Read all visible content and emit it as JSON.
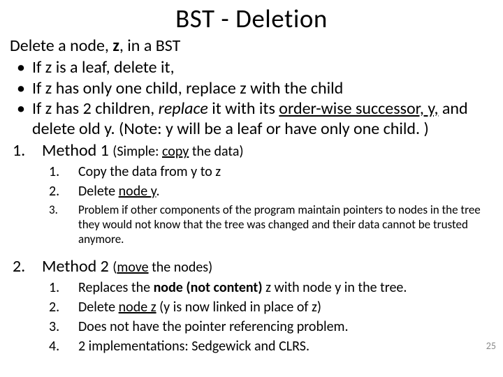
{
  "title": "BST - Deletion",
  "intro_pre": "Delete a node, ",
  "intro_z": "z",
  "intro_post": ", in a BST",
  "bul_mark": "•",
  "b1": "If z is a leaf, delete it,",
  "b2": "If z has only one child, replace z with the child",
  "b3_a": "If z has 2 children, ",
  "b3_replace": "replace",
  "b3_b": " it with its ",
  "b3_succ": "order-wise successor, y,",
  "b3_c": " and delete old y. (Note: y will be a leaf or have only one child. )",
  "m1_num": "1.",
  "m1_label": "Method 1 ",
  "m1_paren_a": "(Simple: ",
  "m1_paren_copy": "copy",
  "m1_paren_b": " the data)",
  "m1s1n": "1.",
  "m1s1": "Copy the data from y to z",
  "m1s2n": "2.",
  "m1s2_a": "Delete ",
  "m1s2_ny": "node y",
  "m1s2_b": ".",
  "m1s3n": "3.",
  "m1s3": "Problem if other components of the program maintain pointers to nodes in the tree they would not know that the tree was changed and their data cannot be trusted anymore.",
  "m2_num": "2.",
  "m2_label": "Method 2 ",
  "m2_paren_a": "(",
  "m2_paren_move": "move",
  "m2_paren_b": " the nodes)",
  "m2s1n": "1.",
  "m2s1_a": "Replaces the ",
  "m2s1_b": "node (not content)",
  "m2s1_c": " z with node y in the tree.",
  "m2s2n": "2.",
  "m2s2_a": "Delete ",
  "m2s2_nz": "node z",
  "m2s2_b": " (y is now linked in place of z)",
  "m2s3n": "3.",
  "m2s3": "Does not have the pointer referencing problem.",
  "m2s4n": "4.",
  "m2s4": "2 implementations:  Sedgewick and CLRS.",
  "pagenum": "25"
}
